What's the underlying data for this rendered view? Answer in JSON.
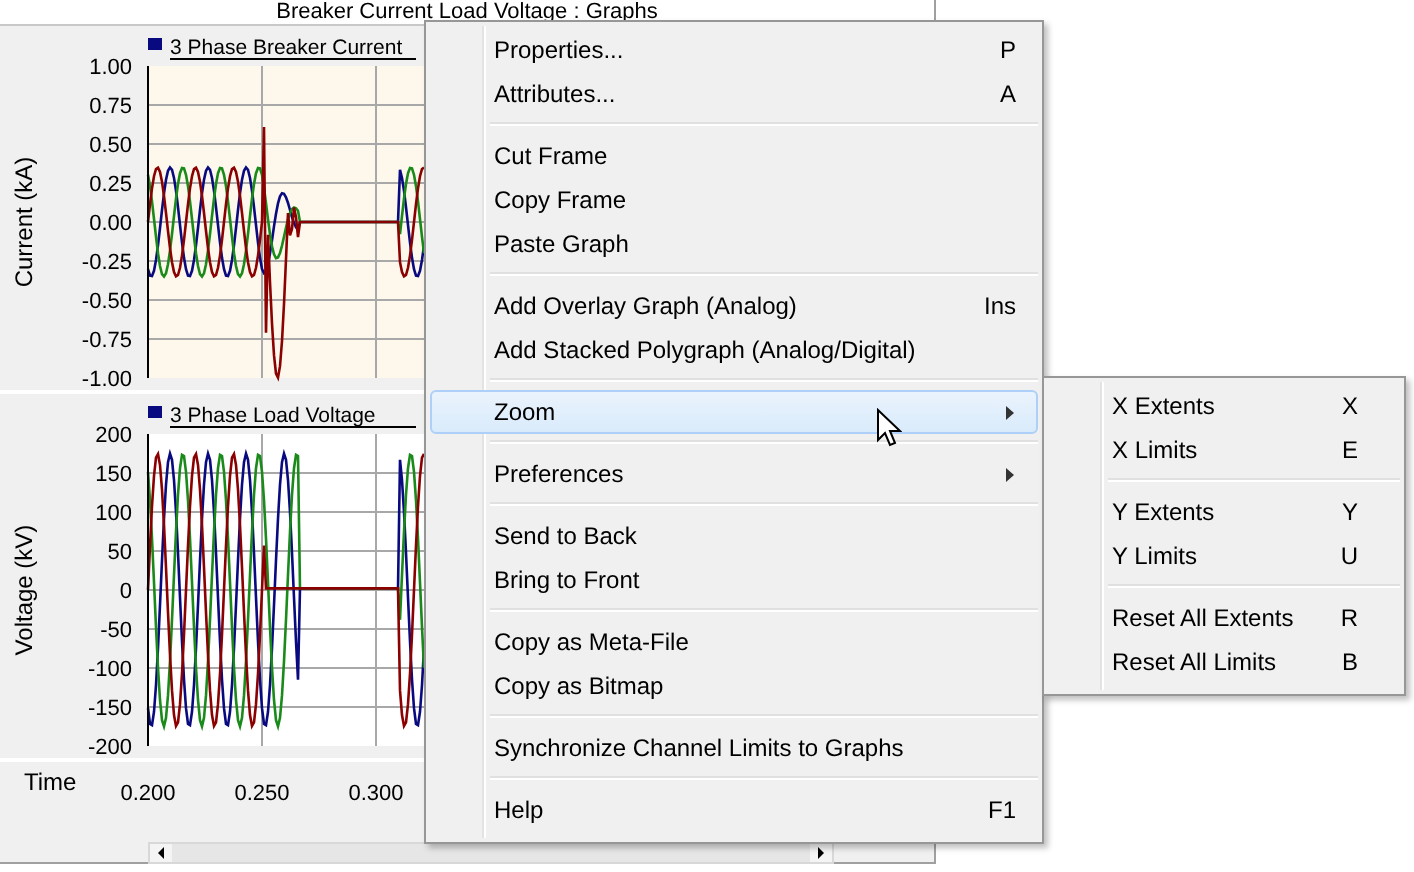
{
  "window": {
    "title": "Breaker Current Load Voltage : Graphs"
  },
  "graphs": [
    {
      "kind": "current",
      "legend": "3 Phase Breaker Current",
      "y_axis_title": "Current (kA)",
      "y_ticks": [
        "1.00",
        "0.75",
        "0.50",
        "0.25",
        "0.00",
        "-0.25",
        "-0.50",
        "-0.75",
        "-1.00"
      ]
    },
    {
      "kind": "voltage",
      "legend": "3 Phase Load Voltage",
      "y_axis_title": "Voltage (kV)",
      "y_ticks": [
        "200",
        "150",
        "100",
        "50",
        "0",
        "-50",
        "-100",
        "-150",
        "-200"
      ]
    }
  ],
  "time_axis": {
    "label": "Time",
    "ticks": [
      "0.200",
      "0.250",
      "0.300"
    ]
  },
  "context_menu": {
    "groups": [
      [
        {
          "label": "Properties...",
          "shortcut": "P",
          "selected": false,
          "has_submenu": false
        },
        {
          "label": "Attributes...",
          "shortcut": "A",
          "selected": false,
          "has_submenu": false
        }
      ],
      [
        {
          "label": "Cut Frame",
          "selected": false,
          "has_submenu": false
        },
        {
          "label": "Copy Frame",
          "selected": false,
          "has_submenu": false
        },
        {
          "label": "Paste Graph",
          "selected": false,
          "has_submenu": false
        }
      ],
      [
        {
          "label": "Add Overlay Graph (Analog)",
          "shortcut": "Ins",
          "selected": false,
          "has_submenu": false
        },
        {
          "label": "Add Stacked Polygraph (Analog/Digital)",
          "selected": false,
          "has_submenu": false
        }
      ],
      [
        {
          "label": "Zoom",
          "selected": true,
          "has_submenu": true
        }
      ],
      [
        {
          "label": "Preferences",
          "selected": false,
          "has_submenu": true
        }
      ],
      [
        {
          "label": "Send to Back",
          "selected": false,
          "has_submenu": false
        },
        {
          "label": "Bring to Front",
          "selected": false,
          "has_submenu": false
        }
      ],
      [
        {
          "label": "Copy as Meta-File",
          "selected": false,
          "has_submenu": false
        },
        {
          "label": "Copy as Bitmap",
          "selected": false,
          "has_submenu": false
        }
      ],
      [
        {
          "label": "Synchronize Channel Limits to Graphs",
          "selected": false,
          "has_submenu": false
        }
      ],
      [
        {
          "label": "Help",
          "shortcut": "F1",
          "selected": false,
          "has_submenu": false
        }
      ]
    ]
  },
  "zoom_submenu": {
    "groups": [
      [
        {
          "label": "X Extents",
          "shortcut": "X",
          "selected": false,
          "has_submenu": false
        },
        {
          "label": "X Limits",
          "shortcut": "E",
          "selected": false,
          "has_submenu": false
        }
      ],
      [
        {
          "label": "Y Extents",
          "shortcut": "Y",
          "selected": false,
          "has_submenu": false
        },
        {
          "label": "Y Limits",
          "shortcut": "U",
          "selected": false,
          "has_submenu": false
        }
      ],
      [
        {
          "label": "Reset All Extents",
          "shortcut": "R",
          "selected": false,
          "has_submenu": false
        },
        {
          "label": "Reset All Limits",
          "shortcut": "B",
          "selected": false,
          "has_submenu": false
        }
      ]
    ]
  }
}
